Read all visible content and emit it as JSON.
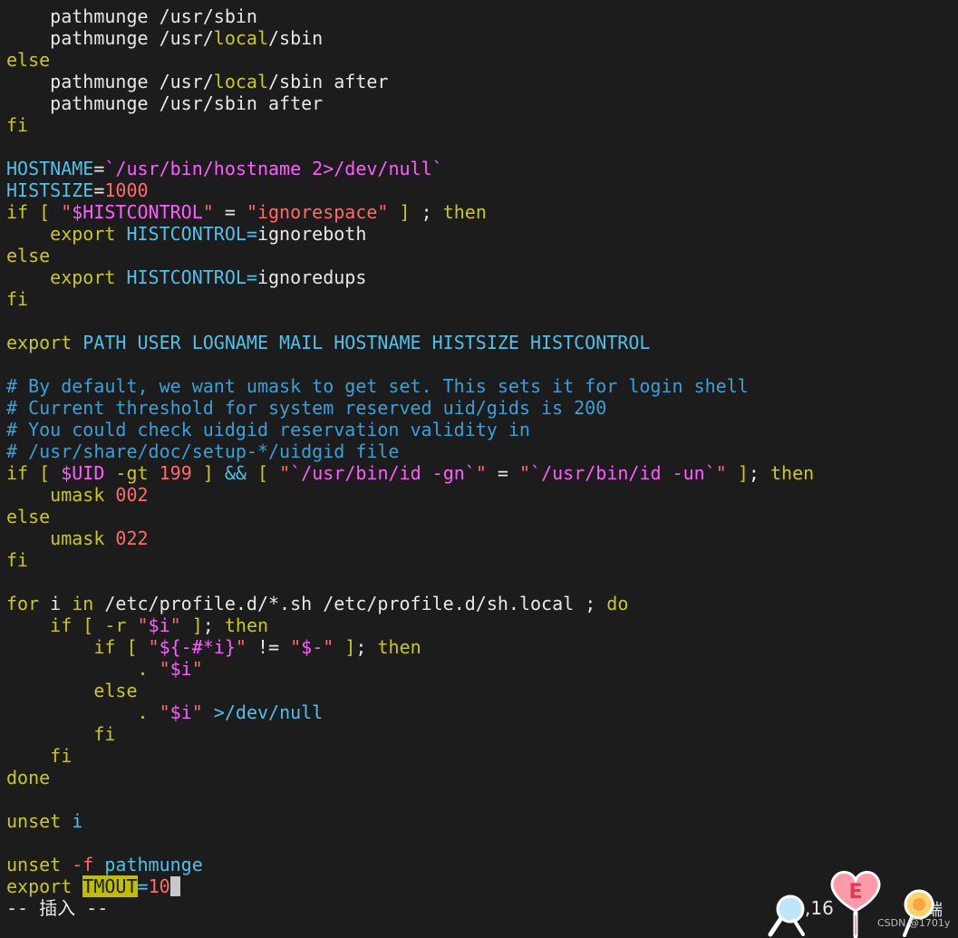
{
  "editor": {
    "colors": {
      "default": "#e8e8e8",
      "keyword": "#c8c81e",
      "variable": "#4fc1e9",
      "string": "#ff5cff",
      "number": "#ff6a6a",
      "comment": "#3aa0d8",
      "operator": "#4fc1e9"
    },
    "lines": [
      [
        {
          "t": "    pathmunge /usr/sbin",
          "c": "default"
        }
      ],
      [
        {
          "t": "    pathmunge /usr/",
          "c": "default"
        },
        {
          "t": "local",
          "c": "keyword"
        },
        {
          "t": "/sbin",
          "c": "default"
        }
      ],
      [
        {
          "t": "else",
          "c": "keyword"
        }
      ],
      [
        {
          "t": "    pathmunge /usr/",
          "c": "default"
        },
        {
          "t": "local",
          "c": "keyword"
        },
        {
          "t": "/sbin after",
          "c": "default"
        }
      ],
      [
        {
          "t": "    pathmunge /usr/sbin after",
          "c": "default"
        }
      ],
      [
        {
          "t": "fi",
          "c": "keyword"
        }
      ],
      [
        {
          "t": "",
          "c": "default"
        }
      ],
      [
        {
          "t": "HOSTNAME",
          "c": "variable"
        },
        {
          "t": "=",
          "c": "default"
        },
        {
          "t": "`/usr/bin/hostname 2>/dev/null`",
          "c": "string"
        }
      ],
      [
        {
          "t": "HISTSIZE",
          "c": "variable"
        },
        {
          "t": "=",
          "c": "default"
        },
        {
          "t": "1000",
          "c": "number"
        }
      ],
      [
        {
          "t": "if",
          "c": "keyword"
        },
        {
          "t": " [ ",
          "c": "keyword"
        },
        {
          "t": "\"",
          "c": "number"
        },
        {
          "t": "$HISTCONTROL",
          "c": "string"
        },
        {
          "t": "\"",
          "c": "number"
        },
        {
          "t": " = ",
          "c": "default"
        },
        {
          "t": "\"ignorespace\"",
          "c": "number"
        },
        {
          "t": " ] ",
          "c": "keyword"
        },
        {
          "t": "; ",
          "c": "default"
        },
        {
          "t": "then",
          "c": "keyword"
        }
      ],
      [
        {
          "t": "    export ",
          "c": "keyword"
        },
        {
          "t": "HISTCONTROL",
          "c": "variable"
        },
        {
          "t": "=",
          "c": "variable"
        },
        {
          "t": "ignoreboth",
          "c": "default"
        }
      ],
      [
        {
          "t": "else",
          "c": "keyword"
        }
      ],
      [
        {
          "t": "    export ",
          "c": "keyword"
        },
        {
          "t": "HISTCONTROL",
          "c": "variable"
        },
        {
          "t": "=",
          "c": "variable"
        },
        {
          "t": "ignoredups",
          "c": "default"
        }
      ],
      [
        {
          "t": "fi",
          "c": "keyword"
        }
      ],
      [
        {
          "t": "",
          "c": "default"
        }
      ],
      [
        {
          "t": "export ",
          "c": "keyword"
        },
        {
          "t": "PATH USER LOGNAME MAIL HOSTNAME HISTSIZE HISTCONTROL",
          "c": "variable"
        }
      ],
      [
        {
          "t": "",
          "c": "default"
        }
      ],
      [
        {
          "t": "# By default, we want umask to get set. This sets it for login shell",
          "c": "comment"
        }
      ],
      [
        {
          "t": "# Current threshold for system reserved uid/gids is 200",
          "c": "comment"
        }
      ],
      [
        {
          "t": "# You could check uidgid reservation validity in",
          "c": "comment"
        }
      ],
      [
        {
          "t": "# /usr/share/doc/setup-*/uidgid file",
          "c": "comment"
        }
      ],
      [
        {
          "t": "if",
          "c": "keyword"
        },
        {
          "t": " [ ",
          "c": "keyword"
        },
        {
          "t": "$UID",
          "c": "string"
        },
        {
          "t": " -gt ",
          "c": "keyword"
        },
        {
          "t": "199",
          "c": "number"
        },
        {
          "t": " ] ",
          "c": "keyword"
        },
        {
          "t": "&&",
          "c": "operator"
        },
        {
          "t": " [ ",
          "c": "keyword"
        },
        {
          "t": "\"",
          "c": "number"
        },
        {
          "t": "`/usr/bin/id -gn`",
          "c": "string"
        },
        {
          "t": "\"",
          "c": "number"
        },
        {
          "t": " = ",
          "c": "default"
        },
        {
          "t": "\"",
          "c": "number"
        },
        {
          "t": "`/usr/bin/id -un`",
          "c": "string"
        },
        {
          "t": "\"",
          "c": "number"
        },
        {
          "t": " ]",
          "c": "keyword"
        },
        {
          "t": "; ",
          "c": "default"
        },
        {
          "t": "then",
          "c": "keyword"
        }
      ],
      [
        {
          "t": "    umask ",
          "c": "keyword"
        },
        {
          "t": "002",
          "c": "number"
        }
      ],
      [
        {
          "t": "else",
          "c": "keyword"
        }
      ],
      [
        {
          "t": "    umask ",
          "c": "keyword"
        },
        {
          "t": "022",
          "c": "number"
        }
      ],
      [
        {
          "t": "fi",
          "c": "keyword"
        }
      ],
      [
        {
          "t": "",
          "c": "default"
        }
      ],
      [
        {
          "t": "for",
          "c": "keyword"
        },
        {
          "t": " i ",
          "c": "default"
        },
        {
          "t": "in",
          "c": "keyword"
        },
        {
          "t": " /etc/profile.d/*.sh /etc/profile.d/sh.local ; ",
          "c": "default"
        },
        {
          "t": "do",
          "c": "keyword"
        }
      ],
      [
        {
          "t": "    if",
          "c": "keyword"
        },
        {
          "t": " [ ",
          "c": "keyword"
        },
        {
          "t": "-r ",
          "c": "keyword"
        },
        {
          "t": "\"",
          "c": "number"
        },
        {
          "t": "$i",
          "c": "string"
        },
        {
          "t": "\"",
          "c": "number"
        },
        {
          "t": " ]",
          "c": "keyword"
        },
        {
          "t": "; ",
          "c": "default"
        },
        {
          "t": "then",
          "c": "keyword"
        }
      ],
      [
        {
          "t": "        if",
          "c": "keyword"
        },
        {
          "t": " [ ",
          "c": "keyword"
        },
        {
          "t": "\"",
          "c": "number"
        },
        {
          "t": "${-#*i}",
          "c": "string"
        },
        {
          "t": "\"",
          "c": "number"
        },
        {
          "t": " != ",
          "c": "default"
        },
        {
          "t": "\"",
          "c": "number"
        },
        {
          "t": "$-",
          "c": "string"
        },
        {
          "t": "\"",
          "c": "number"
        },
        {
          "t": " ]",
          "c": "keyword"
        },
        {
          "t": "; ",
          "c": "default"
        },
        {
          "t": "then",
          "c": "keyword"
        }
      ],
      [
        {
          "t": "            . ",
          "c": "keyword"
        },
        {
          "t": "\"",
          "c": "number"
        },
        {
          "t": "$i",
          "c": "string"
        },
        {
          "t": "\"",
          "c": "number"
        }
      ],
      [
        {
          "t": "        else",
          "c": "keyword"
        }
      ],
      [
        {
          "t": "            . ",
          "c": "keyword"
        },
        {
          "t": "\"",
          "c": "number"
        },
        {
          "t": "$i",
          "c": "string"
        },
        {
          "t": "\"",
          "c": "number"
        },
        {
          "t": " >",
          "c": "operator"
        },
        {
          "t": "/dev/null",
          "c": "variable"
        }
      ],
      [
        {
          "t": "        fi",
          "c": "keyword"
        }
      ],
      [
        {
          "t": "    fi",
          "c": "keyword"
        }
      ],
      [
        {
          "t": "done",
          "c": "keyword"
        }
      ],
      [
        {
          "t": "",
          "c": "default"
        }
      ],
      [
        {
          "t": "unset ",
          "c": "keyword"
        },
        {
          "t": "i",
          "c": "variable"
        }
      ],
      [
        {
          "t": "",
          "c": "default"
        }
      ],
      [
        {
          "t": "unset ",
          "c": "keyword"
        },
        {
          "t": "-f ",
          "c": "number"
        },
        {
          "t": "pathmunge",
          "c": "variable"
        }
      ]
    ],
    "last_line": {
      "prefix": "export ",
      "highlighted": "TMOUT",
      "assign": "=",
      "value": "10"
    }
  },
  "statusbar": {
    "mode": "-- 插入 --",
    "position": ",16",
    "corner_text": "端"
  },
  "watermark": "CSDN @1701y",
  "stickers": [
    "magnifier-sticker",
    "heart-e-sticker",
    "lollipop-sticker",
    "cake-sticker"
  ]
}
